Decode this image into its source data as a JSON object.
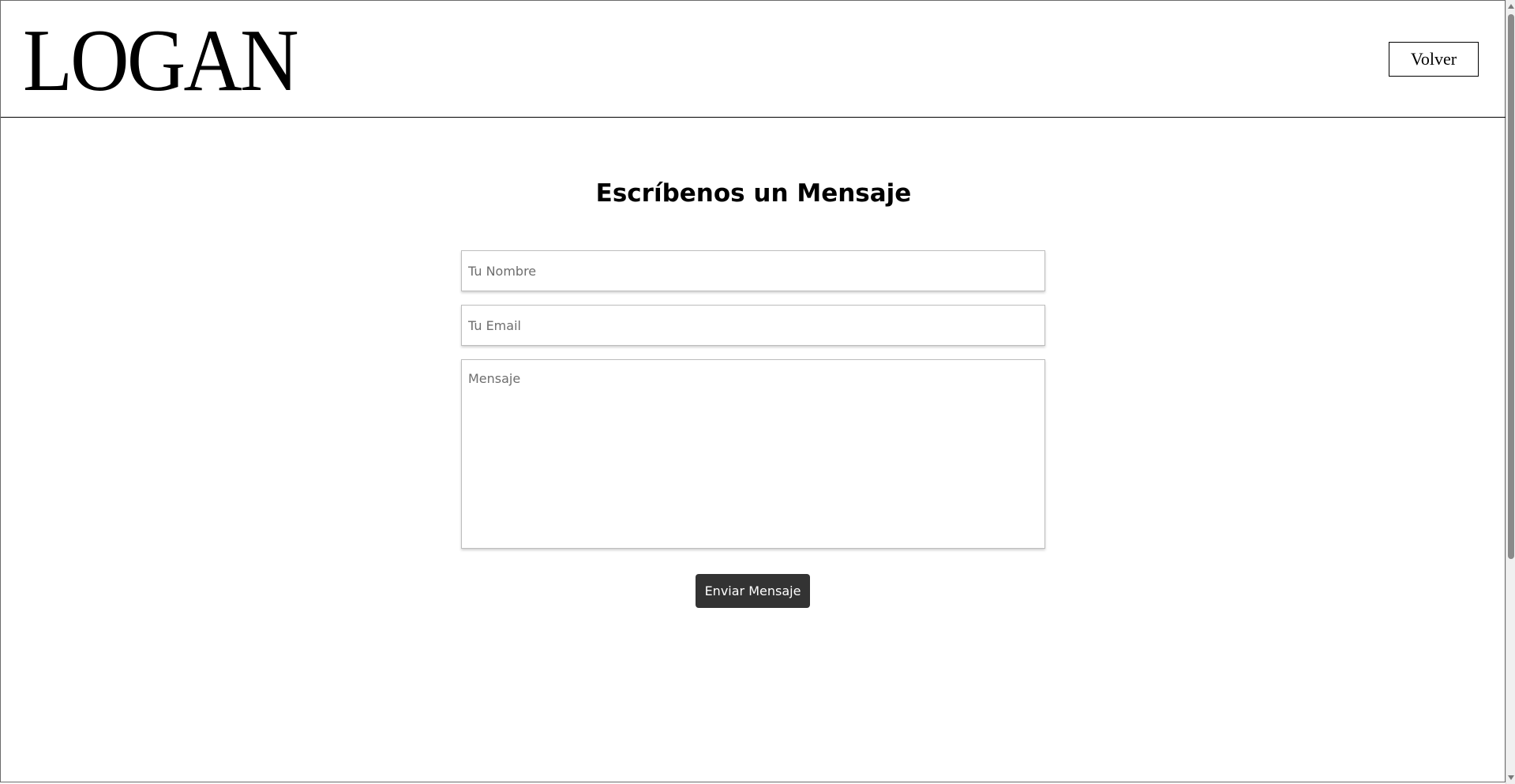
{
  "header": {
    "logo_text": "LOGAN",
    "back_label": "Volver"
  },
  "form": {
    "title": "Escríbenos un Mensaje",
    "name_placeholder": "Tu Nombre",
    "email_placeholder": "Tu Email",
    "message_placeholder": "Mensaje",
    "submit_label": "Enviar Mensaje"
  },
  "colors": {
    "button_bg": "#333333",
    "button_text": "#ffffff",
    "header_border": "#000000"
  },
  "icons": {
    "scroll_up": "triangle-up-icon",
    "scroll_down": "triangle-down-icon"
  }
}
